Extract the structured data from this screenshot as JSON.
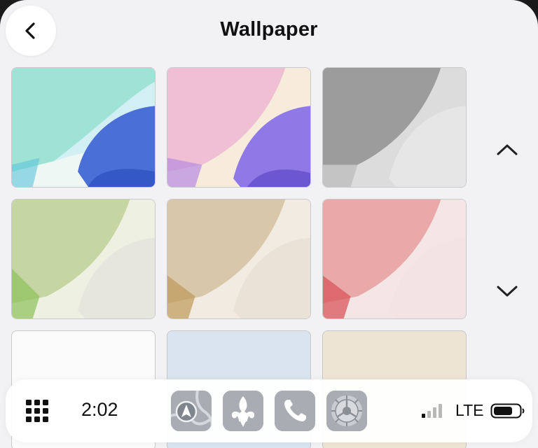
{
  "header": {
    "title": "Wallpaper",
    "back_icon": "chevron-left-icon"
  },
  "wallpapers": [
    {
      "name": "teal-blue",
      "colors": [
        "#9fe3d6",
        "#d9f0ee",
        "#4a6fd6",
        "#f7f4ea"
      ]
    },
    {
      "name": "pink-purple",
      "colors": [
        "#efbfd4",
        "#f7efde",
        "#8e79e6",
        "#fbf4e8"
      ]
    },
    {
      "name": "gray",
      "colors": [
        "#9c9c9c",
        "#cfcfcf",
        "#d8d8d8",
        "#efefef"
      ]
    },
    {
      "name": "green",
      "colors": [
        "#c6d6a3",
        "#e3ebcf",
        "#e7e6de",
        "#f2f1ea"
      ]
    },
    {
      "name": "tan",
      "colors": [
        "#d8c7a8",
        "#ece3d2",
        "#e9e1d6",
        "#f4efe8"
      ]
    },
    {
      "name": "red",
      "colors": [
        "#e9a9a9",
        "#f3cfcf",
        "#f3e2e2",
        "#f7eeee"
      ]
    },
    {
      "name": "white",
      "colors": [
        "#fbfbfb"
      ]
    },
    {
      "name": "light-blue",
      "colors": [
        "#d9e4ee"
      ]
    },
    {
      "name": "cream",
      "colors": [
        "#ede4d4"
      ]
    }
  ],
  "scroll": {
    "up_icon": "chevron-up-icon",
    "down_icon": "chevron-down-icon"
  },
  "dock": {
    "apps_icon": "grid-icon",
    "time": "2:02",
    "apps": [
      "maps-icon",
      "fleur-de-lis-icon",
      "phone-icon",
      "settings-gear-icon"
    ],
    "signal_bars": 1,
    "network": "LTE",
    "battery_level": 0.7
  }
}
